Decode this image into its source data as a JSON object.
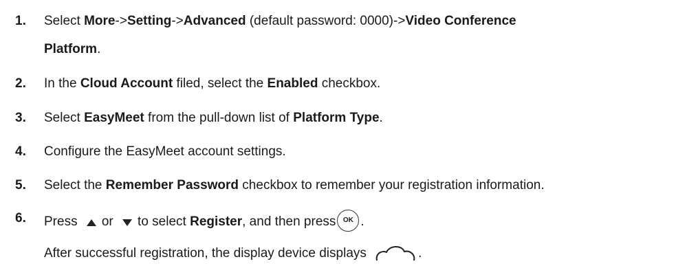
{
  "steps": [
    {
      "num": "1.",
      "l1": [
        "Select ",
        "More",
        "->",
        "Setting",
        "->",
        "Advanced",
        " (default password: 0000)->",
        "Video Conference"
      ],
      "l2": [
        "Platform",
        "."
      ]
    },
    {
      "num": "2.",
      "l1": [
        "In the ",
        "Cloud Account",
        " filed, select the ",
        "Enabled",
        " checkbox."
      ]
    },
    {
      "num": "3.",
      "l1": [
        "Select ",
        "EasyMeet",
        " from the pull-down list of ",
        "Platform Type",
        "."
      ]
    },
    {
      "num": "4.",
      "l1": [
        "Configure the EasyMeet account settings."
      ]
    },
    {
      "num": "5.",
      "l1": [
        "Select the ",
        "Remember Password",
        " checkbox to remember your registration information."
      ]
    },
    {
      "num": "6.",
      "l1": [
        "Press",
        "or",
        "to select ",
        "Register",
        ", and then press",
        "."
      ],
      "ok_label": "OK",
      "l2": [
        "After successful registration, the display device displays",
        "."
      ]
    }
  ],
  "icons": [
    "up-arrow-icon",
    "down-arrow-icon",
    "ok-key-icon",
    "cloud-icon"
  ]
}
